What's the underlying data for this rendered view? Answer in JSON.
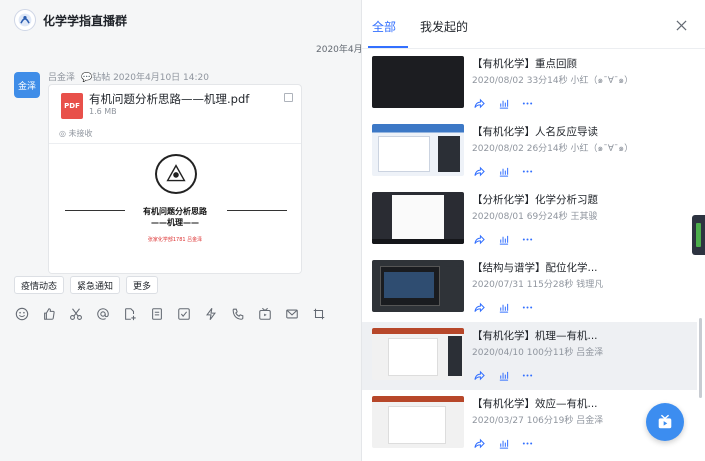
{
  "chat": {
    "group_title": "化学学指直播群",
    "date_separator": "2020年4月",
    "message": {
      "avatar_text": "金泽",
      "sender": "吕金泽",
      "tag": "💬钻帖 2020年4月10日 14:20",
      "file": {
        "icon_label": "PDF",
        "name": "有机问题分析思路——机理.pdf",
        "size": "1.6 MB",
        "status": "未接收",
        "preview_title": "有机问题分析思路",
        "preview_subtitle": "——机理——",
        "preview_note": "张家化学部1781 吕金泽"
      }
    },
    "quick_actions": [
      "疫情动态",
      "紧急通知",
      "更多"
    ],
    "toolbar_icons": [
      "emoji-icon",
      "thumb-icon",
      "scissors-icon",
      "at-icon",
      "file-upload-icon",
      "doc-icon",
      "check-icon",
      "lightning-icon",
      "phone-icon",
      "live-icon",
      "mail-icon",
      "screenshot-icon"
    ]
  },
  "panel": {
    "tabs": [
      "全部",
      "我发起的"
    ],
    "active_tab": "全部",
    "items": [
      {
        "title": "【有机化学】重点回顾",
        "meta": "2020/08/02 33分14秒 小红（๑¯∀¯๑）"
      },
      {
        "title": "【有机化学】人名反应导读",
        "meta": "2020/08/02 26分14秒 小红（๑¯∀¯๑）"
      },
      {
        "title": "【分析化学】化学分析习题",
        "meta": "2020/08/01 69分24秒 王其骏"
      },
      {
        "title": "【结构与谱学】配位化学...",
        "meta": "2020/07/31 115分28秒 钱理凡"
      },
      {
        "title": "【有机化学】机理—有机...",
        "meta": "2020/04/10 100分11秒 吕金泽"
      },
      {
        "title": "【有机化学】效应—有机...",
        "meta": "2020/03/27 106分19秒 吕金泽"
      }
    ]
  },
  "colors": {
    "accent": "#3370ff",
    "fab": "#3c8df0",
    "pdf": "#e8504a"
  }
}
